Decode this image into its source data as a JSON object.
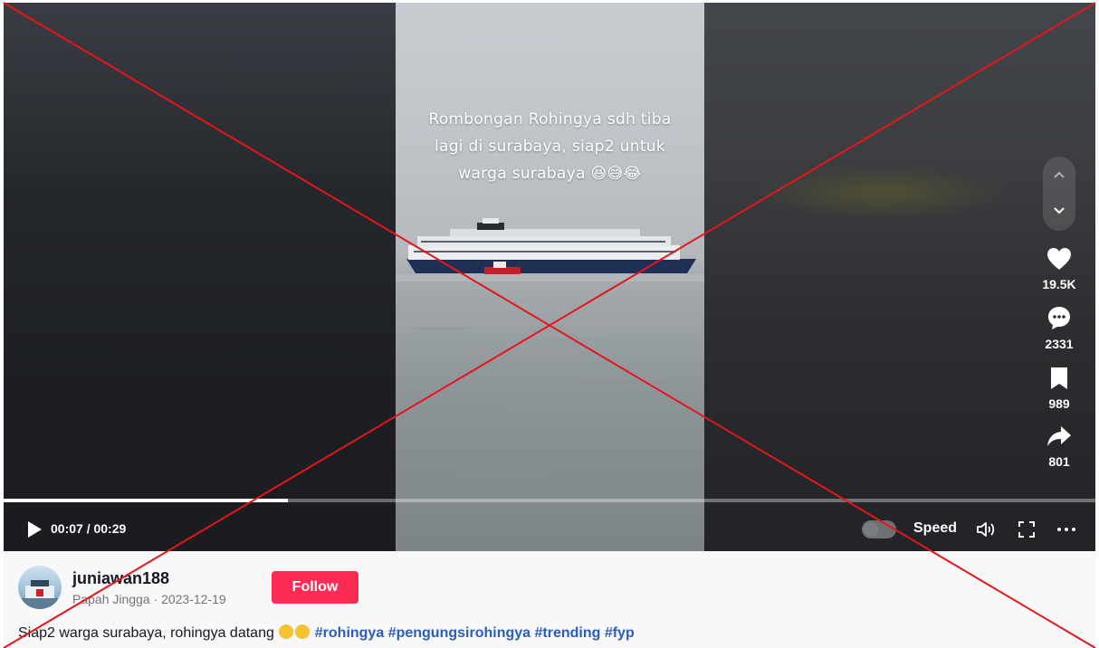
{
  "video": {
    "caption": "Rombongan Rohingya sdh tiba\nlagi di surabaya, siap2 untuk\nwarga surabaya 😆😅😂"
  },
  "actions": {
    "likes": "19.5K",
    "comments": "2331",
    "saves": "989",
    "shares": "801"
  },
  "player": {
    "time": "00:07 / 00:29",
    "progress": 0.26,
    "speed_label": "Speed"
  },
  "author": {
    "username": "juniawan188",
    "display_and_date": "Papah Jingga · 2023-12-19",
    "follow_label": "Follow"
  },
  "description": {
    "text": "Siap2 warga surabaya, rohingya datang",
    "hashtags": [
      "#rohingya",
      "#pengungsirohingya",
      "#trending",
      "#fyp"
    ]
  },
  "icons": [
    "chevron-up-icon",
    "chevron-down-icon",
    "heart-icon",
    "comment-icon",
    "bookmark-icon",
    "share-icon",
    "play-icon",
    "volume-icon",
    "fullscreen-icon",
    "more-icon"
  ],
  "colors": {
    "accent": "#fe2c55",
    "hashtag": "#2b5db9",
    "overlay_x": "#e8141b"
  }
}
